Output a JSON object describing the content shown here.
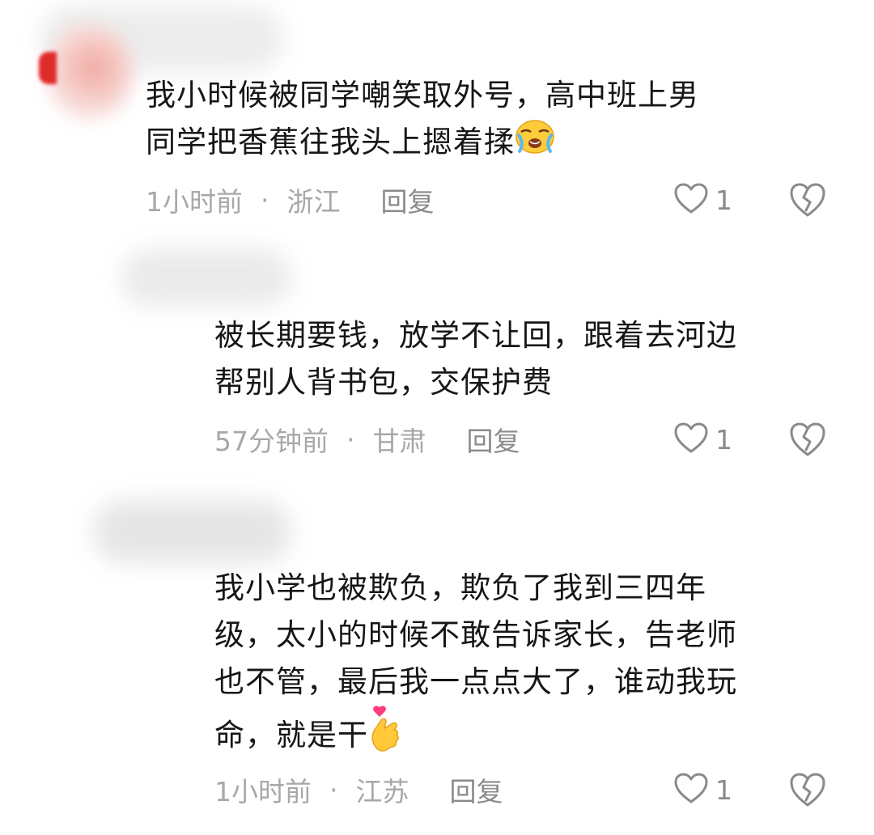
{
  "comments": [
    {
      "text_lines": [
        "我小时候被同学嘲笑取外号，高中班上男",
        "同学把香蕉往我头上摁着揉"
      ],
      "trailing_emoji": "crying-emoji",
      "time": "1小时前",
      "separator": "·",
      "location": "浙江",
      "reply_label": "回复",
      "like_count": "1"
    },
    {
      "text_lines": [
        "被长期要钱，放学不让回，跟着去河边",
        "帮别人背书包，交保护费"
      ],
      "time": "57分钟前",
      "separator": "·",
      "location": "甘肃",
      "reply_label": "回复",
      "like_count": "1"
    },
    {
      "text_lines": [
        "我小学也被欺负，欺负了我到三四年",
        "级，太小的时候不敢告诉家长，告老师",
        "也不管，最后我一点点大了，谁动我玩",
        "命，就是干"
      ],
      "trailing_emoji": "finger-heart-emoji",
      "time": "1小时前",
      "separator": "·",
      "location": "江苏",
      "reply_label": "回复",
      "like_count": "1"
    }
  ],
  "colors": {
    "text": "#161616",
    "meta": "#a8a8a8",
    "icon": "#8a8a8a"
  }
}
